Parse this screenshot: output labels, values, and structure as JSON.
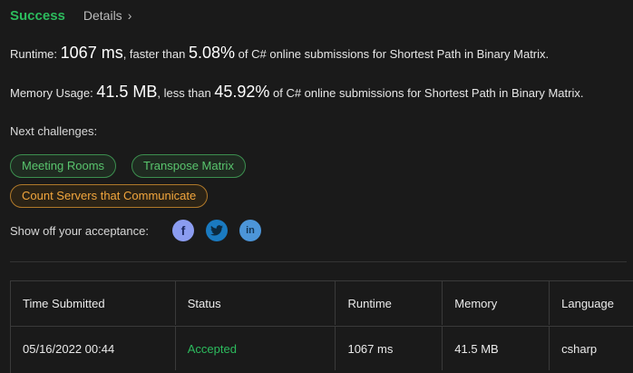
{
  "header": {
    "status": "Success",
    "details_label": "Details",
    "details_chevron": "›"
  },
  "runtime": {
    "label": "Runtime:",
    "value": "1067 ms",
    "compare": ", faster than",
    "percent": "5.08%",
    "suffix": "of C# online submissions for Shortest Path in Binary Matrix."
  },
  "memory": {
    "label": "Memory Usage:",
    "value": "41.5 MB",
    "compare": ", less than",
    "percent": "45.92%",
    "suffix": "of C# online submissions for Shortest Path in Binary Matrix."
  },
  "next": {
    "label": "Next challenges:",
    "challenges": [
      {
        "label": "Meeting Rooms",
        "difficulty_color": "#59c46d"
      },
      {
        "label": "Transpose Matrix",
        "difficulty_color": "#59c46d"
      },
      {
        "label": "Count Servers that Communicate",
        "difficulty_color": "#f2a63d"
      }
    ]
  },
  "share": {
    "label": "Show off your acceptance:",
    "icons": [
      "facebook-icon",
      "twitter-icon",
      "linkedin-icon"
    ]
  },
  "table": {
    "columns": [
      "Time Submitted",
      "Status",
      "Runtime",
      "Memory",
      "Language"
    ],
    "rows": [
      [
        "05/16/2022 00:44",
        "Accepted",
        "1067 ms",
        "41.5 MB",
        "csharp"
      ]
    ]
  },
  "colors": {
    "accent": "#2cbb5d",
    "background": "#1a1a1a"
  }
}
